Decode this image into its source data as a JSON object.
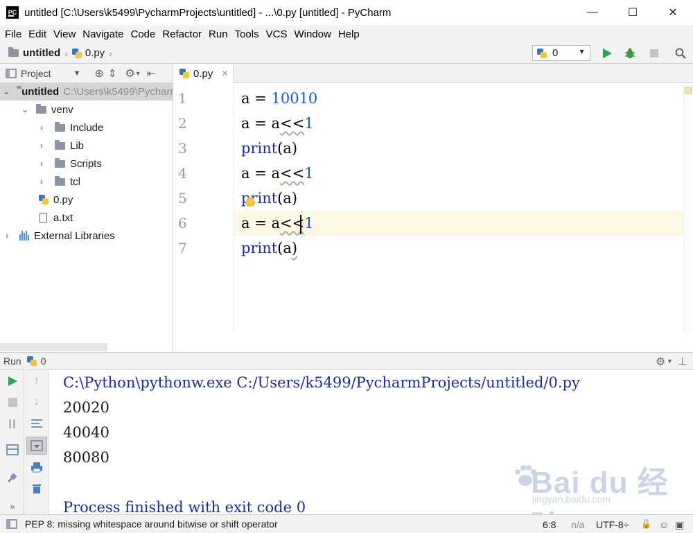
{
  "window": {
    "title": "untitled [C:\\Users\\k5499\\PycharmProjects\\untitled] - ...\\0.py [untitled] - PyCharm",
    "logo_text": "PC",
    "minimize": "—",
    "maximize": "☐",
    "close": "✕"
  },
  "menu": [
    "File",
    "Edit",
    "View",
    "Navigate",
    "Code",
    "Refactor",
    "Run",
    "Tools",
    "VCS",
    "Window",
    "Help"
  ],
  "navbar": {
    "project": "untitled",
    "file": "0.py",
    "run_config": "0"
  },
  "project_panel": {
    "title": "Project",
    "root_name": "untitled",
    "root_path": "C:\\Users\\k5499\\PycharmProjects\\untitled",
    "items": [
      "venv",
      "Include",
      "Lib",
      "Scripts",
      "tcl",
      "0.py",
      "a.txt",
      "External Libraries"
    ]
  },
  "editor": {
    "tab": "0.py",
    "line_numbers": [
      "1",
      "2",
      "3",
      "4",
      "5",
      "6",
      "7"
    ],
    "tokens": {
      "a": "a",
      "eq": " = ",
      "n10010": "10010",
      "shift": "<<",
      "one": "1",
      "print": "print",
      "args": "(a)",
      "paren_open": "(",
      "paren_close": ")"
    }
  },
  "run": {
    "label": "Run",
    "config": "0",
    "console": [
      "C:\\Python\\pythonw.exe C:/Users/k5499/PycharmProjects/untitled/0.py",
      "20020",
      "40040",
      "80080",
      "",
      "Process finished with exit code 0"
    ]
  },
  "status": {
    "message": "PEP 8: missing whitespace around bitwise or shift operator",
    "position": "6:8",
    "line_sep": "n/a",
    "encoding": "UTF-8÷"
  },
  "watermark": {
    "text": "Bai du 经验",
    "sub": "jingyan.baidu.com"
  }
}
